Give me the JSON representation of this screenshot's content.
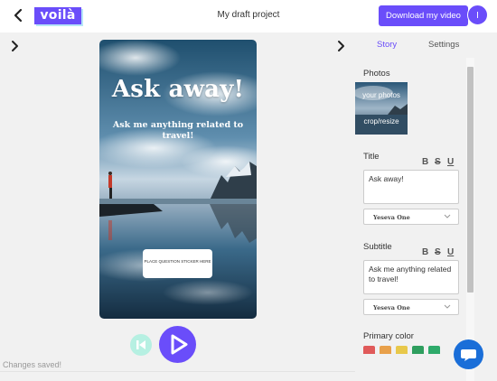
{
  "header": {
    "logo_text": "voilà",
    "project_name": "My draft project",
    "download_label": "Download my video",
    "avatar_initial": "I"
  },
  "story": {
    "title": "Ask away!",
    "subtitle": "Ask me anything related to travel!",
    "sticker_text": "PLACE QUESTION STICKER HERE"
  },
  "status": {
    "text": "Changes saved!"
  },
  "side_panel": {
    "tabs": [
      "Story",
      "Settings"
    ],
    "active_tab": "Story",
    "photos_label": "Photos",
    "photo_actions": [
      "your photos",
      "crop/resize"
    ],
    "title_label": "Title",
    "title_value": "Ask away!",
    "title_font": "Yeseva One",
    "subtitle_label": "Subtitle",
    "subtitle_value": "Ask me anything related to travel!",
    "subtitle_font": "Yeseva One",
    "format_buttons": [
      "B",
      "S",
      "U"
    ],
    "primary_color_label": "Primary color",
    "palette": [
      "#e05a5a",
      "#e8a04a",
      "#e8c84a",
      "#2e9e5e",
      "#2eaa6a"
    ]
  },
  "colors": {
    "accent": "#6a4dfa",
    "accent_light": "#b6e6f7",
    "chat": "#1a6ed8"
  },
  "icons": [
    "back-arrow-icon",
    "chevron-left-icon",
    "chevron-right-icon",
    "rewind-icon",
    "play-icon",
    "chevron-down-icon",
    "chat-icon"
  ]
}
